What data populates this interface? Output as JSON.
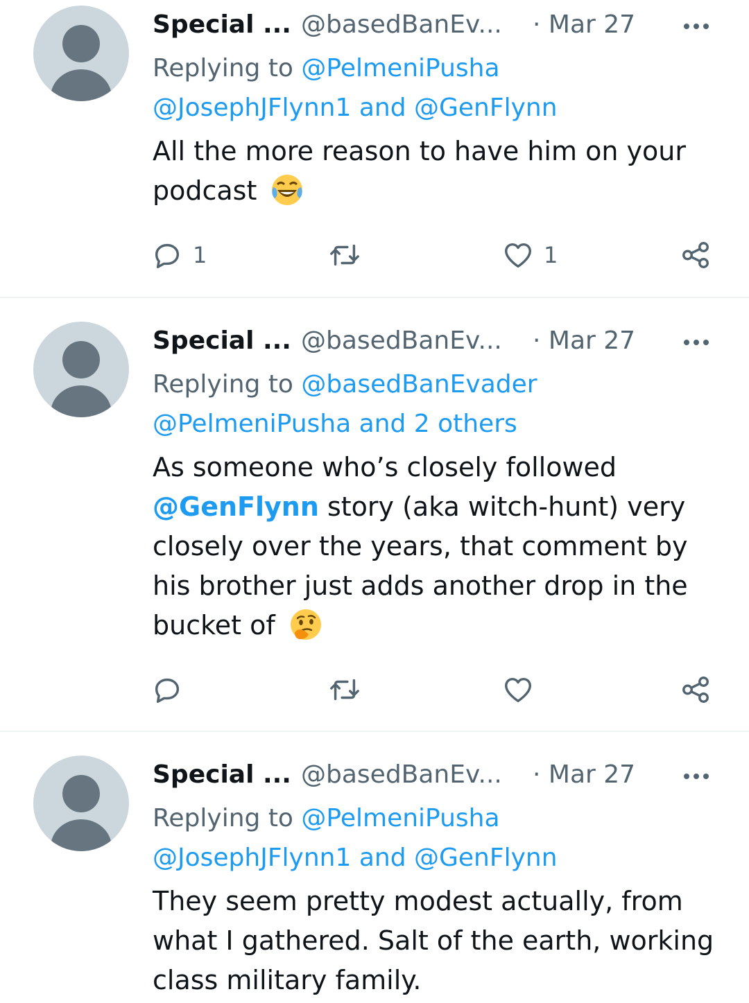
{
  "tweets": [
    {
      "display_name": "Special ...",
      "handle": "@basedBanEv...",
      "date": "· Mar 27",
      "replying_prefix": "Replying to",
      "replying_to_first": "@PelmeniPusha",
      "replying_to_rest": "@JosephJFlynn1 and @GenFlynn",
      "text_before": "All the more reason to have him on your podcast",
      "mention": "",
      "text_after": "",
      "emoji": "face-with-tears-of-joy",
      "reply_count": "1",
      "retweet_count": "",
      "like_count": "1"
    },
    {
      "display_name": "Special ...",
      "handle": "@basedBanEv...",
      "date": "· Mar 27",
      "replying_prefix": "Replying to",
      "replying_to_first": "@basedBanEvader",
      "replying_to_rest": "@PelmeniPusha and 2 others",
      "text_before": "As someone who’s closely followed",
      "mention": "@GenFlynn",
      "text_after": "story (aka witch-hunt) very closely over the years, that comment by his brother just adds another drop in the bucket of",
      "emoji": "thinking-face",
      "reply_count": "",
      "retweet_count": "",
      "like_count": ""
    },
    {
      "display_name": "Special ...",
      "handle": "@basedBanEv...",
      "date": "· Mar 27",
      "replying_prefix": "Replying to",
      "replying_to_first": "@PelmeniPusha",
      "replying_to_rest": "@JosephJFlynn1 and @GenFlynn",
      "text_before": "They seem pretty modest actually, from what I gathered. Salt of the earth, working class military family.",
      "mention": "",
      "text_after": "",
      "emoji": "",
      "reply_count": "",
      "retweet_count": "",
      "like_count": ""
    }
  ],
  "colors": {
    "link": "#1d9bf0",
    "secondary_text": "#536471",
    "primary_text": "#0f1419",
    "divider": "#eff3f4",
    "avatar_bg": "#ccd6dd",
    "avatar_fg": "#66757f"
  },
  "icons": [
    "reply-icon",
    "retweet-icon",
    "like-icon",
    "share-icon",
    "more-icon"
  ]
}
